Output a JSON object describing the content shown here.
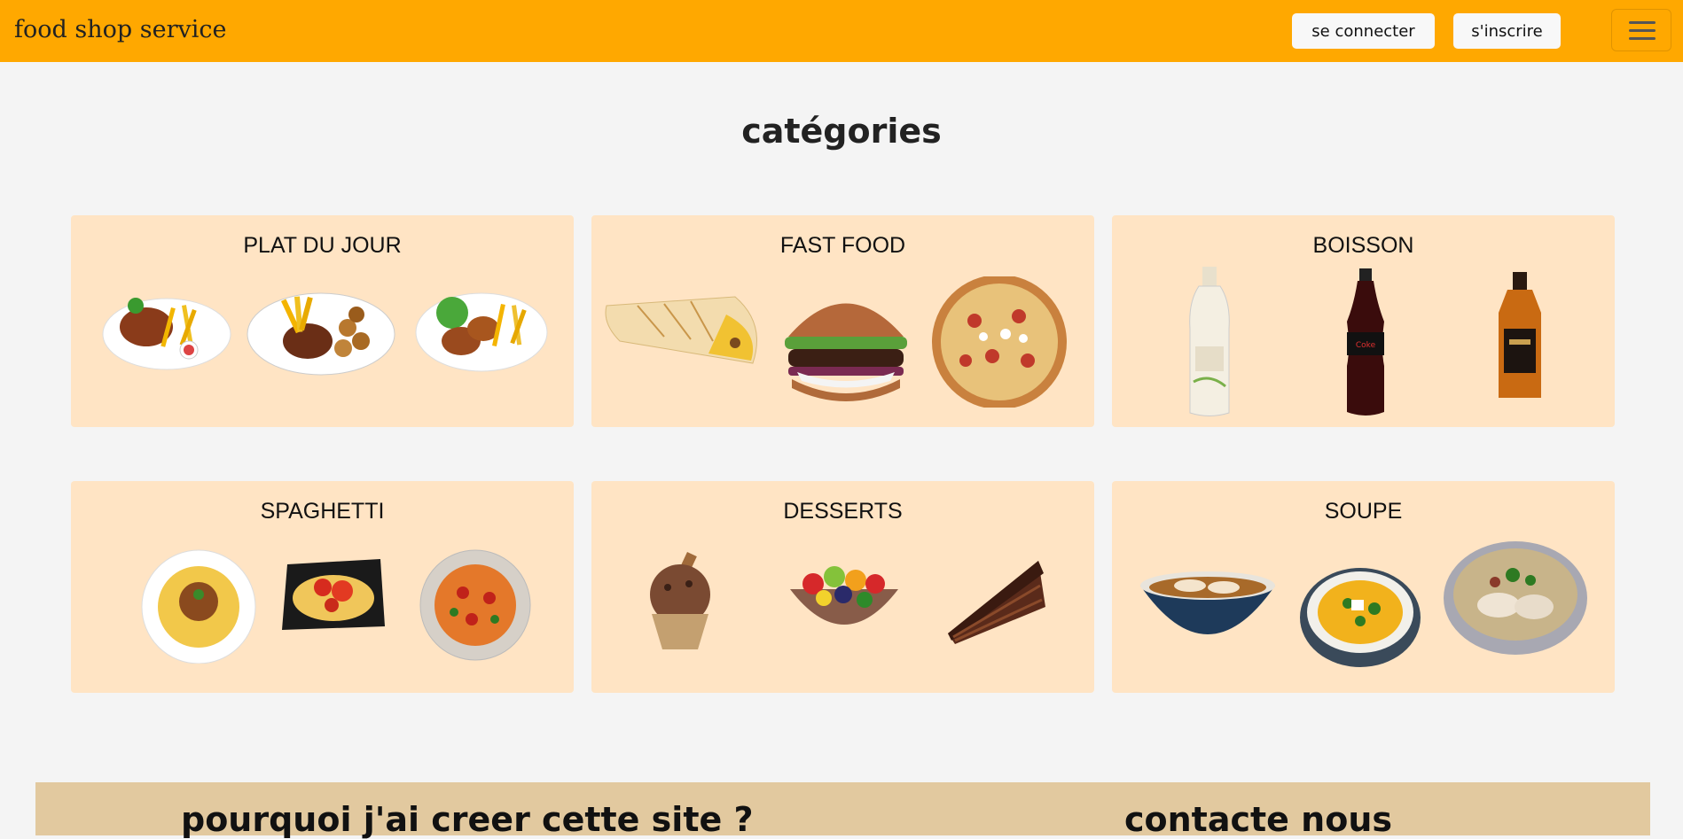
{
  "navbar": {
    "brand": "food shop service",
    "login_label": "se connecter",
    "signup_label": "s'inscrire",
    "menu_icon": "hamburger-menu-icon"
  },
  "page_title": "catégories",
  "categories": [
    {
      "title": "PLAT DU JOUR",
      "items": [
        "grilled-chicken-fries-plate-image",
        "steak-fries-plate-image",
        "chicken-legs-salad-plate-image"
      ]
    },
    {
      "title": "FAST FOOD",
      "items": [
        "wrap-tacos-image",
        "burger-image",
        "pizza-image"
      ]
    },
    {
      "title": "BOISSON",
      "items": [
        "cream-liqueur-bottle-image",
        "cola-zero-bottle-image",
        "whisky-bottle-image"
      ]
    },
    {
      "title": "SPAGHETTI",
      "items": [
        "spaghetti-bolognese-image",
        "spaghetti-peppers-image",
        "spaghetti-tomato-image"
      ]
    },
    {
      "title": "DESSERTS",
      "items": [
        "chocolate-ice-cream-image",
        "fruit-salad-image",
        "chocolate-cake-slice-image"
      ]
    },
    {
      "title": "SOUPE",
      "items": [
        "dumpling-soup-image",
        "pumpkin-soup-image",
        "noodle-soup-image"
      ]
    }
  ],
  "footer": {
    "why_title": "pourquoi j'ai creer cette site ?",
    "contact_title": "contacte nous"
  },
  "colors": {
    "navbar": "#ffa800",
    "card_bg": "#ffe4c4",
    "footer_bg": "#e2c99f",
    "page_bg": "#f4f4f4"
  }
}
